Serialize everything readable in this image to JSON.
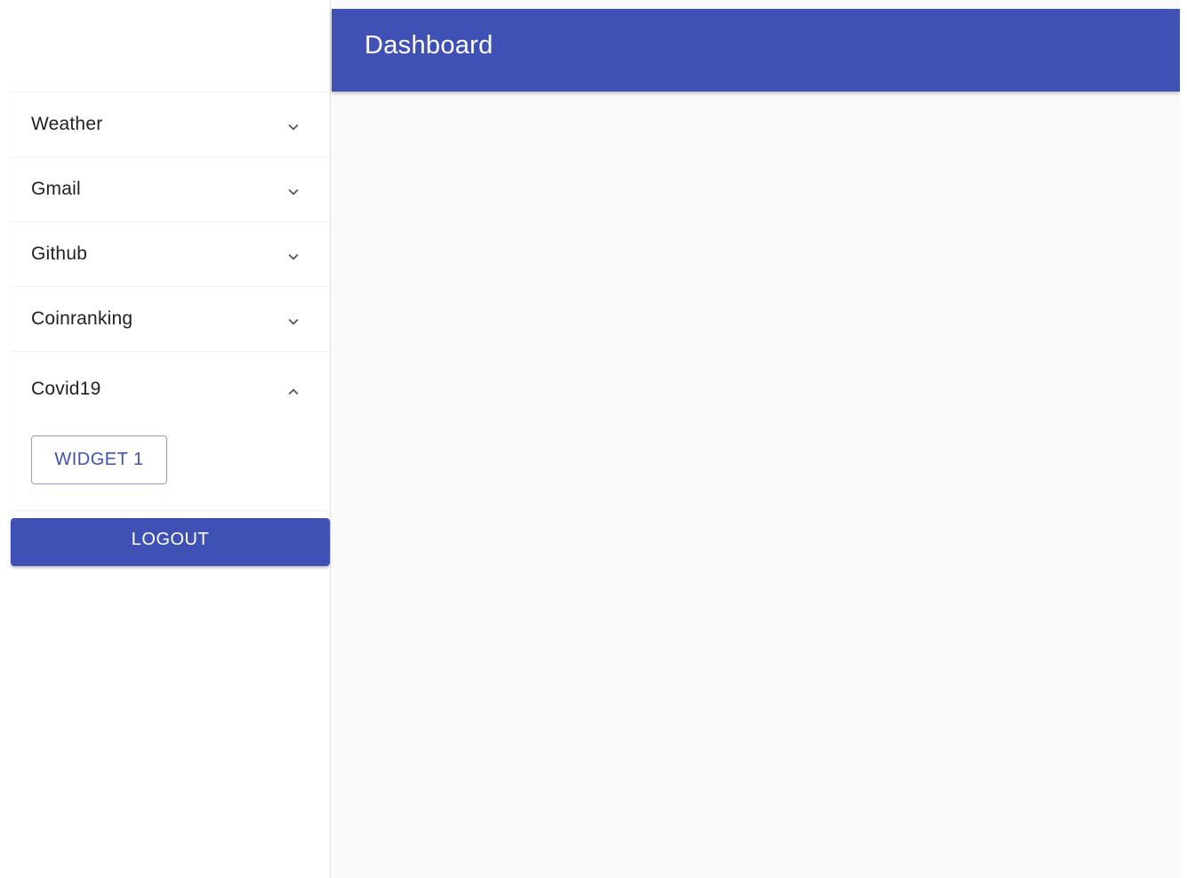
{
  "header": {
    "title": "Dashboard"
  },
  "sidebar": {
    "items": [
      {
        "label": "Weather",
        "expanded": false,
        "icon": "chevron-down-icon"
      },
      {
        "label": "Gmail",
        "expanded": false,
        "icon": "chevron-down-icon"
      },
      {
        "label": "Github",
        "expanded": false,
        "icon": "chevron-down-icon"
      },
      {
        "label": "Coinranking",
        "expanded": false,
        "icon": "chevron-down-icon"
      },
      {
        "label": "Covid19",
        "expanded": true,
        "icon": "chevron-up-icon",
        "widgets": [
          "WIDGET 1"
        ]
      }
    ],
    "logout_label": "LOGOUT"
  },
  "colors": {
    "primary": "#3f51b5",
    "background": "#fafafa",
    "text": "#212121"
  }
}
